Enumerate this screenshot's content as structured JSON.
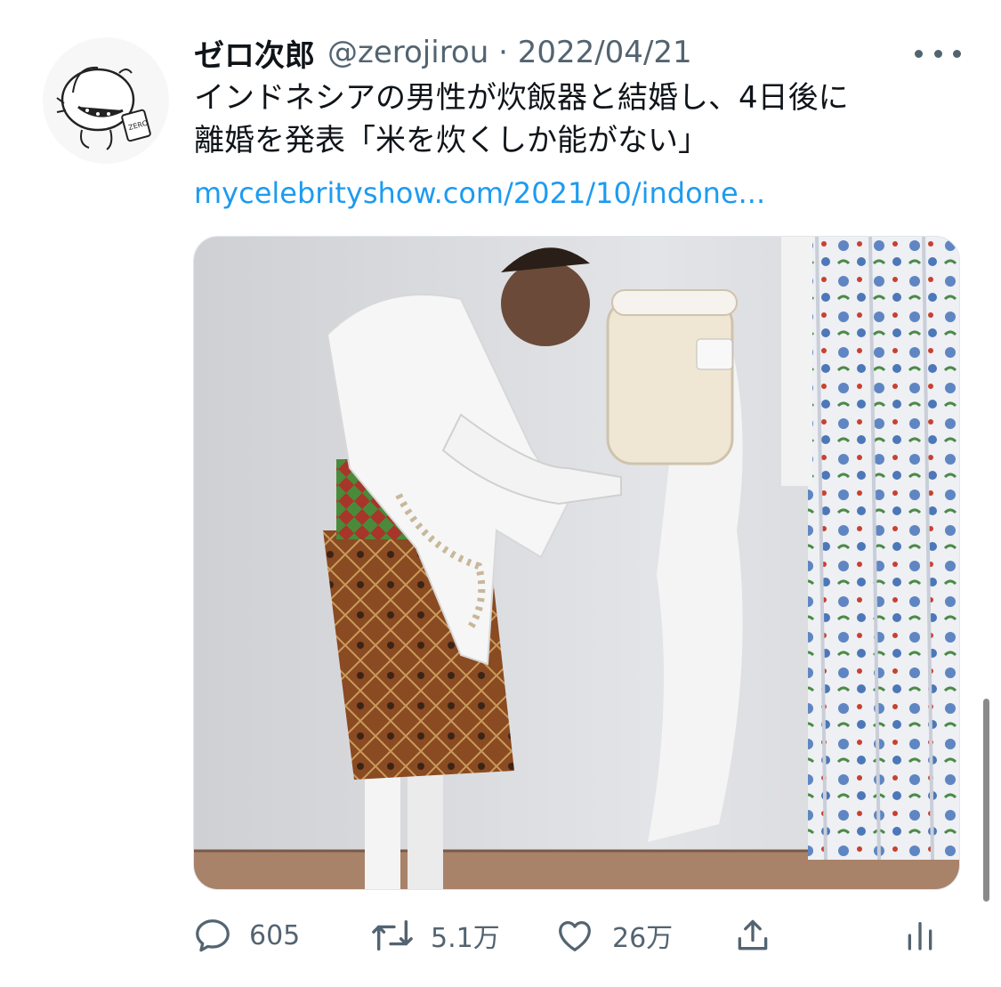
{
  "tweet": {
    "display_name": "ゼロ次郎",
    "handle_date": "@zerojirou · 2022/04/21",
    "text_line1": "インドネシアの男性が炊飯器と結婚し、4日後に",
    "text_line2": "離婚を発表「米を炊くしか能がない」",
    "link": "mycelebrityshow.com/2021/10/indone..."
  },
  "actions": {
    "reply_count": "605",
    "retweet_count": "5.1万",
    "like_count": "26万"
  },
  "icons": {
    "reply": "speech-bubble-icon",
    "retweet": "retweet-icon",
    "like": "heart-icon",
    "share": "share-icon",
    "analytics": "bar-chart-icon",
    "more": "ellipsis-icon"
  },
  "colors": {
    "link": "#1d9bf0",
    "secondary_text": "#536471",
    "primary_text": "#0f1419"
  }
}
